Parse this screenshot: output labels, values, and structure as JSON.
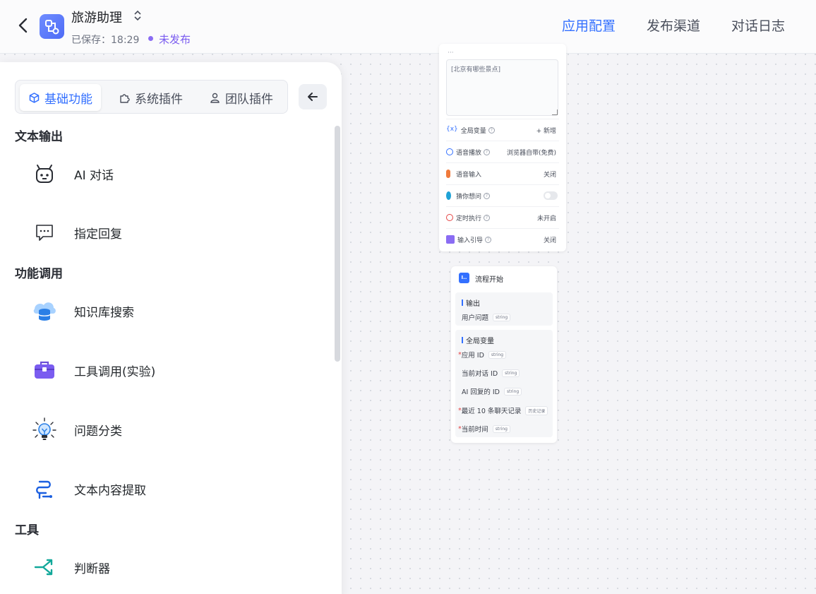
{
  "header": {
    "app_name": "旅游助理",
    "saved_label": "已保存：18:29",
    "status": "未发布",
    "nav": [
      {
        "label": "应用配置",
        "active": true
      },
      {
        "label": "发布渠道",
        "active": false
      },
      {
        "label": "对话日志",
        "active": false
      }
    ]
  },
  "panel": {
    "tabs": [
      {
        "label": "基础功能",
        "icon": "cube-icon",
        "active": true
      },
      {
        "label": "系统插件",
        "icon": "puzzle-icon",
        "active": false
      },
      {
        "label": "团队插件",
        "icon": "user-icon",
        "active": false
      }
    ],
    "sections": [
      {
        "title": "文本输出",
        "items": [
          {
            "label": "AI 对话",
            "icon": "robot-icon"
          },
          {
            "label": "指定回复",
            "icon": "chat-bubble-icon"
          }
        ]
      },
      {
        "title": "功能调用",
        "items": [
          {
            "label": "知识库搜索",
            "icon": "database-icon"
          },
          {
            "label": "工具调用(实验)",
            "icon": "toolbox-icon"
          },
          {
            "label": "问题分类",
            "icon": "lightbulb-icon"
          },
          {
            "label": "文本内容提取",
            "icon": "extract-icon"
          }
        ]
      },
      {
        "title": "工具",
        "items": [
          {
            "label": "判断器",
            "icon": "branch-icon"
          }
        ]
      }
    ]
  },
  "config_card": {
    "textarea_value": "[北京有哪些景点]",
    "rows": [
      {
        "label": "全局变量",
        "value": "+ 新增"
      },
      {
        "label": "语音播放",
        "value": "浏览器自带(免费)"
      },
      {
        "label": "语音输入",
        "value": "关闭"
      },
      {
        "label": "猜你想问",
        "value": ""
      },
      {
        "label": "定时执行",
        "value": "未开启"
      },
      {
        "label": "输入引导",
        "value": "关闭"
      }
    ]
  },
  "flow_card": {
    "title": "流程开始",
    "output_title": "输出",
    "outputs": [
      {
        "label": "用户问题",
        "type": "string"
      }
    ],
    "global_title": "全局变量",
    "globals": [
      {
        "label": "应用 ID",
        "type": "string",
        "required": true
      },
      {
        "label": "当前对话 ID",
        "type": "string",
        "required": false
      },
      {
        "label": "AI 回复的 ID",
        "type": "string",
        "required": false
      },
      {
        "label": "最近 10 条聊天记录",
        "type": "历史记录",
        "required": true
      },
      {
        "label": "当前时间",
        "type": "string",
        "required": true
      }
    ]
  },
  "colors": {
    "accent": "#3370ff",
    "status": "#7a5cf0"
  }
}
